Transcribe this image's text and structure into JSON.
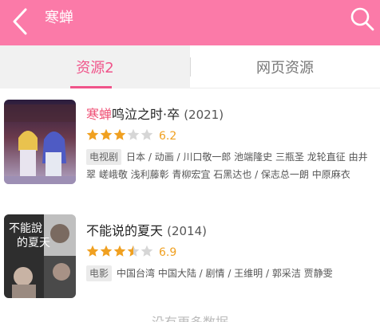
{
  "header": {
    "title": "寒蝉",
    "back_icon": "chevron-left-icon",
    "search_icon": "search-icon",
    "color": "#fb7aa8"
  },
  "tabs": [
    {
      "label": "资源2",
      "active": true
    },
    {
      "label": "网页资源",
      "active": false
    }
  ],
  "results": [
    {
      "title_highlight": "寒蝉",
      "title_rest": "鸣泣之时·卒",
      "year": "(2021)",
      "rating": 6.2,
      "stars": 3,
      "score": "6.2",
      "category": "电视剧",
      "meta": "日本 / 动画 / 川口敬一郎 池端隆史 三瓶圣 龙轮直征 由井翠 嵯峨敬 浅利藤彰 青柳宏宜 石黑达也 / 保志总一朗 中原麻衣"
    },
    {
      "title_highlight": "",
      "title_rest": "不能说的夏天",
      "year": "(2014)",
      "rating": 6.9,
      "stars": 3.5,
      "score": "6.9",
      "category": "电影",
      "meta": "中国台湾 中国大陆 / 剧情 / 王维明 / 郭采洁 贾静雯"
    }
  ],
  "footer": {
    "text": "没有更多数据"
  },
  "colors": {
    "accent": "#f0548a",
    "star": "#f0a020",
    "star_empty": "#d6d6d6"
  }
}
